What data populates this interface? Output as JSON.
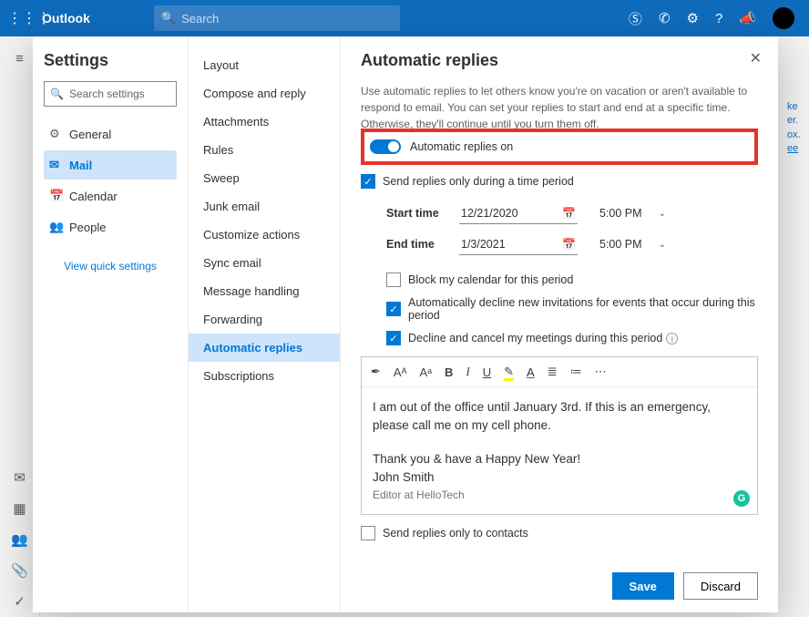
{
  "app": {
    "name": "Outlook",
    "search_placeholder": "Search"
  },
  "background_hints": [
    "ke",
    "er.",
    "ox.",
    "ee"
  ],
  "settings": {
    "title": "Settings",
    "search_placeholder": "Search settings",
    "categories": [
      {
        "icon": "⚙",
        "label": "General"
      },
      {
        "icon": "✉",
        "label": "Mail",
        "active": true
      },
      {
        "icon": "📅",
        "label": "Calendar"
      },
      {
        "icon": "👥",
        "label": "People"
      }
    ],
    "view_quick": "View quick settings",
    "mail_subs": [
      "Layout",
      "Compose and reply",
      "Attachments",
      "Rules",
      "Sweep",
      "Junk email",
      "Customize actions",
      "Sync email",
      "Message handling",
      "Forwarding",
      "Automatic replies",
      "Subscriptions"
    ],
    "mail_sub_active": "Automatic replies"
  },
  "panel": {
    "title": "Automatic replies",
    "description": "Use automatic replies to let others know you're on vacation or aren't available to respond to email. You can set your replies to start and end at a specific time. Otherwise, they'll continue until you turn them off.",
    "toggle_label": "Automatic replies on",
    "send_during_period": "Send replies only during a time period",
    "start_label": "Start time",
    "end_label": "End time",
    "start_date": "12/21/2020",
    "end_date": "1/3/2021",
    "start_time": "5:00 PM",
    "end_time": "5:00 PM",
    "opt_block": "Block my calendar for this period",
    "opt_decline_new": "Automatically decline new invitations for events that occur during this period",
    "opt_cancel": "Decline and cancel my meetings during this period",
    "body_p1": "I am out of the office until January 3rd. If this is an emergency, please call me on my cell phone.",
    "body_p2": "Thank you & have a Happy New Year!",
    "sig1": "John Smith",
    "sig2": "Editor at HelloTech",
    "contacts_only": "Send replies only to contacts",
    "save": "Save",
    "discard": "Discard"
  }
}
